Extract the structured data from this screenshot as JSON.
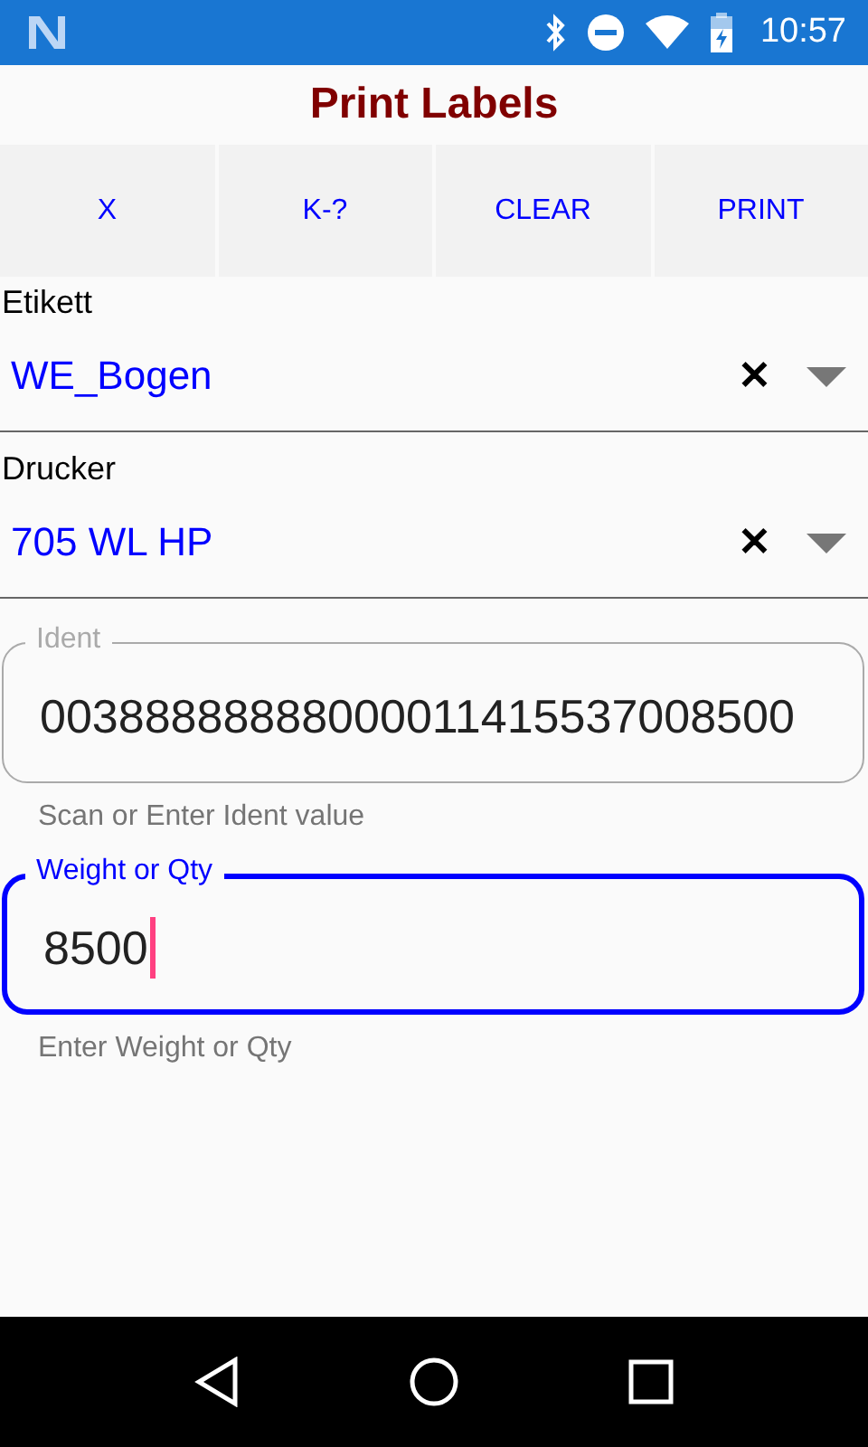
{
  "status_bar": {
    "time": "10:57"
  },
  "title": "Print Labels",
  "toolbar": [
    {
      "label": "X"
    },
    {
      "label": "K-?"
    },
    {
      "label": "CLEAR"
    },
    {
      "label": "PRINT"
    }
  ],
  "pickers": [
    {
      "label": "Etikett",
      "value": "WE_Bogen",
      "clear": "✕"
    },
    {
      "label": "Drucker",
      "value": "705 WL HP",
      "clear": "✕"
    }
  ],
  "fields": [
    {
      "label": "Ident",
      "value": "00388888888000011415537008500",
      "helper": "Scan or Enter Ident value",
      "focused": false
    },
    {
      "label": "Weight or Qty",
      "value": "8500",
      "helper": "Enter Weight or Qty",
      "focused": true
    }
  ]
}
